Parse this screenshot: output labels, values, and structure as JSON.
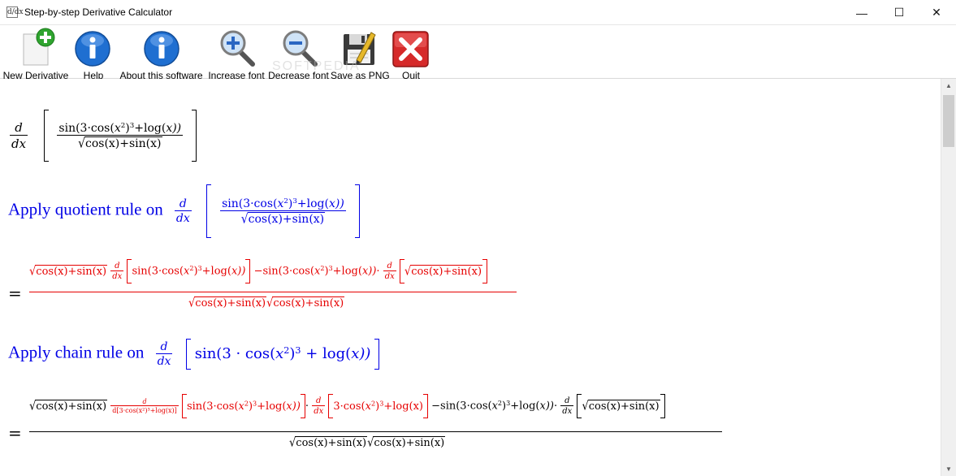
{
  "window": {
    "title": "Step-by-step Derivative Calculator",
    "app_icon_glyph": "d/dx",
    "controls": {
      "minimize": "—",
      "maximize": "☐",
      "close": "✕"
    }
  },
  "toolbar": {
    "new_derivative": "New Derivative",
    "help": "Help",
    "about": "About this software",
    "increase_font": "Increase font",
    "decrease_font": "Decrease font",
    "save_png": "Save as PNG",
    "quit": "Quit"
  },
  "watermark": "SOFTPEDIA",
  "colors": {
    "step_text": "#0000e6",
    "result_expr": "#e60000",
    "input_expr": "#000000",
    "quit_red": "#d62a2a",
    "help_blue": "#1f6fd1"
  },
  "icons": [
    "new-document-icon",
    "help-info-icon",
    "about-info-icon",
    "zoom-in-icon",
    "zoom-out-icon",
    "save-floppy-icon",
    "quit-x-icon"
  ],
  "scrollbar": {
    "up": "▲",
    "down": "▼"
  },
  "math": {
    "d": "d",
    "dx": "dx",
    "sin_open": "sin(3·cos(",
    "x": "x",
    "two": "2",
    "close_pow": ")",
    "three": "3",
    "plus_log": "+log(",
    "close_x": "x))",
    "cos_sin": "cos(x)+sin(x)",
    "eq": "="
  },
  "steps": {
    "quotient": "Apply quotient rule on",
    "chain": "Apply chain rule on",
    "step1_red_num": "cos(x)+sin(x)",
    "minus_sin": "−sin(3·cos(",
    "dot": "·",
    "chain_big": "sin(3 · cos(",
    "chain_big_log": " + log(",
    "chain_big_end": "x))",
    "chain_inner": "3·cos(",
    "chain_inner_log": "+log(x)",
    "d_arg": "d[3·cos(x²)³+log(x)]"
  }
}
